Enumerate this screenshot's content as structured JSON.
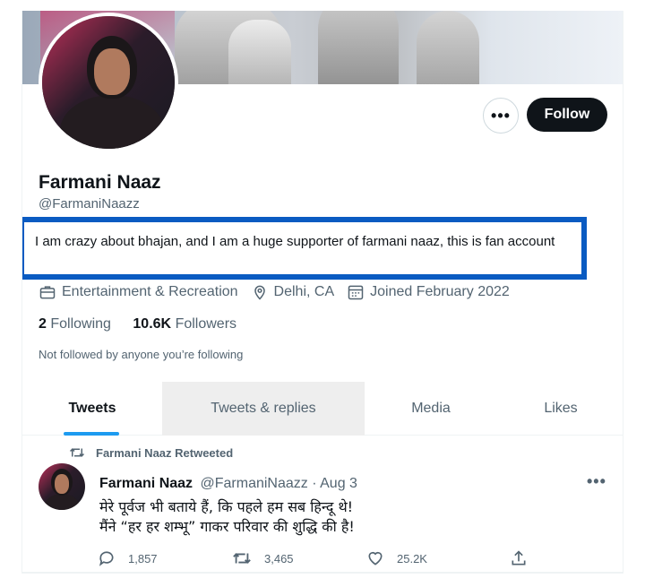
{
  "profile": {
    "name": "Farmani Naaz",
    "handle": "@FarmaniNaazz",
    "bio": "I am crazy about bhajan, and I am a huge supporter of farmani naaz, this is fan account",
    "category": "Entertainment & Recreation",
    "location": "Delhi, CA",
    "joined": "Joined February 2022",
    "following_count": "2",
    "following_label": "Following",
    "followers_count": "10.6K",
    "followers_label": "Followers",
    "not_followed": "Not followed by anyone you’re following"
  },
  "buttons": {
    "more_label": "•••",
    "follow_label": "Follow"
  },
  "tabs": [
    {
      "label": "Tweets",
      "active": true
    },
    {
      "label": "Tweets & replies",
      "active": false
    },
    {
      "label": "Media",
      "active": false
    },
    {
      "label": "Likes",
      "active": false
    }
  ],
  "tweet": {
    "retweet_note": "Farmani Naaz Retweeted",
    "author_name": "Farmani Naaz",
    "author_handle": "@FarmaniNaazz",
    "date": "· Aug 3",
    "more_label": "•••",
    "lines": [
      "मेरे पूर्वज भी बताये हैं, कि पहले हम सब हिन्दू थे!",
      "मैंने “हर हर शम्भू” गाकर परिवार की शुद्धि की है!"
    ],
    "replies": "1,857",
    "retweets": "3,465",
    "likes": "25.2K"
  },
  "icons": {
    "category": "briefcase-icon",
    "location": "location-pin-icon",
    "joined": "calendar-icon",
    "retweet": "retweet-icon",
    "reply": "reply-icon",
    "like": "heart-icon",
    "share": "share-icon"
  },
  "colors": {
    "accent": "#1d9bf0",
    "highlight_box": "#0a5bc2",
    "follow_button": "#0f1419",
    "secondary_text": "#536471"
  }
}
